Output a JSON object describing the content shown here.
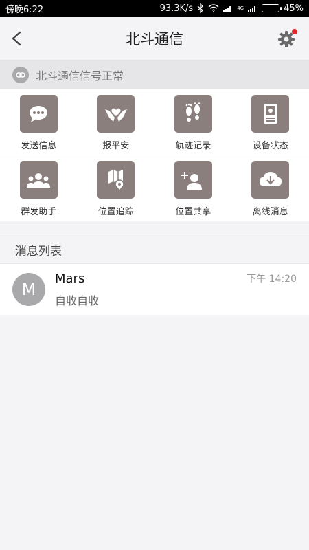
{
  "status_bar": {
    "time": "傍晚6:22",
    "speed": "93.3K/s",
    "network": "4G",
    "battery": "45%",
    "battery_fraction": 0.45
  },
  "header": {
    "title": "北斗通信"
  },
  "signal": {
    "text": "北斗通信信号正常"
  },
  "grid": [
    {
      "label": "发送信息",
      "icon": "chat-bubble-icon"
    },
    {
      "label": "报平安",
      "icon": "hands-heart-icon"
    },
    {
      "label": "轨迹记录",
      "icon": "footprints-icon"
    },
    {
      "label": "设备状态",
      "icon": "device-icon"
    },
    {
      "label": "群发助手",
      "icon": "group-icon"
    },
    {
      "label": "位置追踪",
      "icon": "map-pin-icon"
    },
    {
      "label": "位置共享",
      "icon": "share-user-icon"
    },
    {
      "label": "离线消息",
      "icon": "cloud-download-icon"
    }
  ],
  "messages": {
    "header": "消息列表",
    "items": [
      {
        "avatar_letter": "M",
        "name": "Mars",
        "preview": "自收自收",
        "time": "下午 14:20"
      }
    ]
  },
  "colors": {
    "tile": "#8a7f7c",
    "badge": "#e0262a",
    "background": "#f4f4f6"
  }
}
